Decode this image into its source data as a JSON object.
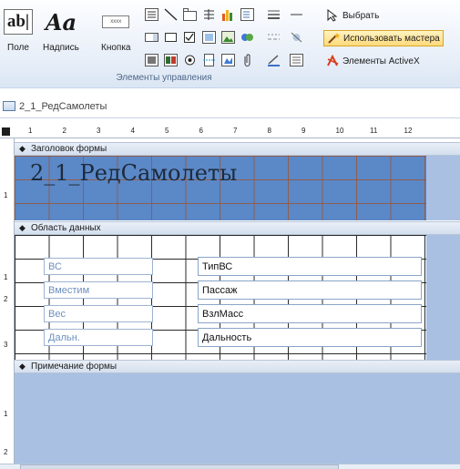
{
  "ribbon": {
    "group_label": "Элементы управления",
    "field_btn": {
      "label": "Поле",
      "glyph": "ab|"
    },
    "caption_btn": {
      "label": "Надпись",
      "glyph": "Aa"
    },
    "button_btn": {
      "label": "Кнопка",
      "glyph": "xxxx"
    },
    "select_cmd": "Выбрать",
    "wizard_cmd": "Использовать мастера",
    "activex_cmd": "Элементы ActiveX"
  },
  "document": {
    "tab_title": "2_1_РедСамолеты"
  },
  "ruler": {
    "marks": [
      "1",
      "2",
      "3",
      "4",
      "5",
      "6",
      "7",
      "8",
      "9",
      "10",
      "11",
      "12"
    ],
    "vmarks": [
      "1",
      "1",
      "2",
      "3",
      "1",
      "2"
    ]
  },
  "sections": {
    "header": "Заголовок формы",
    "detail": "Область данных",
    "footer": "Примечание формы"
  },
  "form": {
    "title": "2_1_РедСамолеты",
    "rows": [
      {
        "label": "ВС",
        "field": "ТипВС"
      },
      {
        "label": "Вместим",
        "field": "Пассаж"
      },
      {
        "label": "Вес",
        "field": "ВзлМасс"
      },
      {
        "label": "Дальн.",
        "field": "Дальность"
      }
    ]
  },
  "colors": {
    "accent": "#5b88c7",
    "section_bg": "#a9c0e2",
    "highlight": "#ffd97a"
  }
}
